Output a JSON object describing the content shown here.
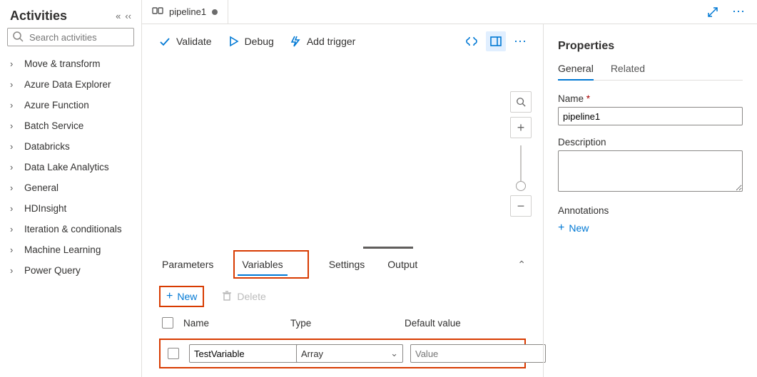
{
  "sidebar": {
    "title": "Activities",
    "search_placeholder": "Search activities",
    "categories": [
      "Move & transform",
      "Azure Data Explorer",
      "Azure Function",
      "Batch Service",
      "Databricks",
      "Data Lake Analytics",
      "General",
      "HDInsight",
      "Iteration & conditionals",
      "Machine Learning",
      "Power Query"
    ]
  },
  "tabs": {
    "pipeline_name": "pipeline1"
  },
  "toolbar": {
    "validate": "Validate",
    "debug": "Debug",
    "add_trigger": "Add trigger"
  },
  "bottom_tabs": {
    "parameters": "Parameters",
    "variables": "Variables",
    "settings": "Settings",
    "output": "Output"
  },
  "vars_panel": {
    "new_label": "New",
    "delete_label": "Delete",
    "col_name": "Name",
    "col_type": "Type",
    "col_default": "Default value",
    "row": {
      "name": "TestVariable",
      "type": "Array",
      "default_placeholder": "Value"
    }
  },
  "props": {
    "title": "Properties",
    "tab_general": "General",
    "tab_related": "Related",
    "name_label": "Name",
    "name_val": "pipeline1",
    "desc_label": "Description",
    "ann_label": "Annotations",
    "ann_new": "New"
  }
}
